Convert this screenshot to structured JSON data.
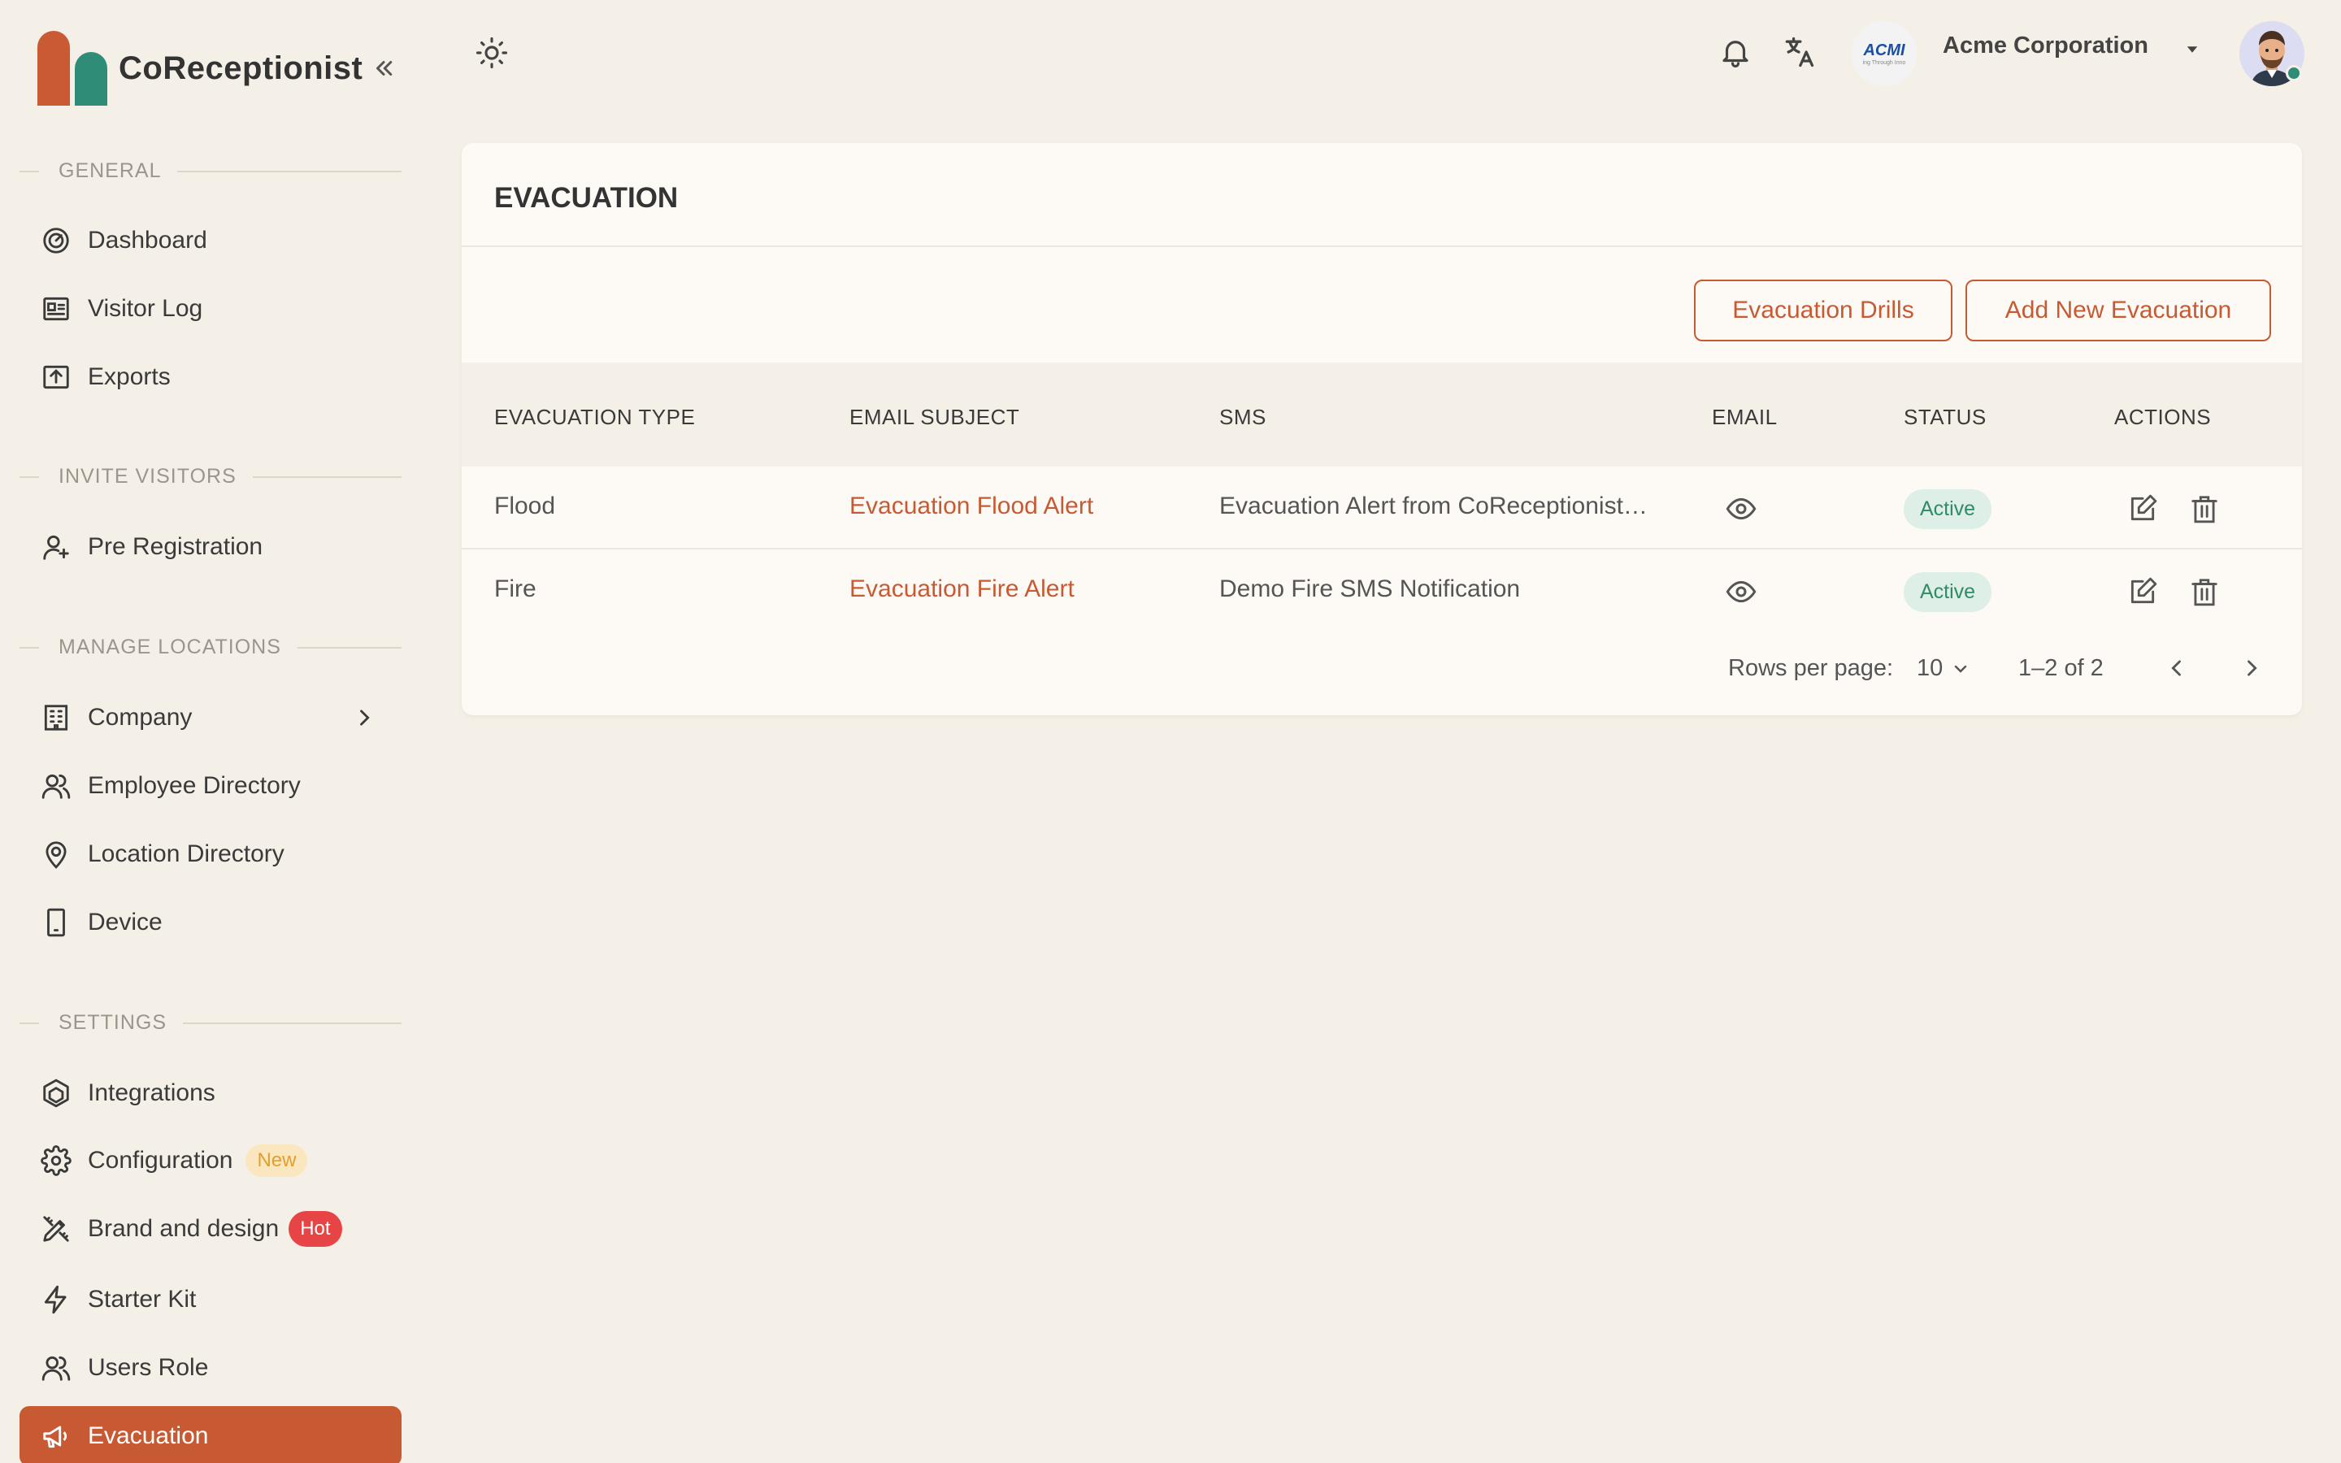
{
  "app": {
    "name": "CoReceptionist"
  },
  "sidebar": {
    "sections": {
      "general": "GENERAL",
      "invite": "INVITE VISITORS",
      "locations": "MANAGE LOCATIONS",
      "settings": "SETTINGS"
    },
    "items": {
      "dashboard": "Dashboard",
      "visitor_log": "Visitor Log",
      "exports": "Exports",
      "pre_registration": "Pre Registration",
      "company": "Company",
      "employee_directory": "Employee Directory",
      "location_directory": "Location Directory",
      "device": "Device",
      "integrations": "Integrations",
      "configuration": "Configuration",
      "configuration_badge": "New",
      "brand_design": "Brand and design",
      "brand_design_badge": "Hot",
      "starter_kit": "Starter Kit",
      "users_role": "Users Role",
      "evacuation": "Evacuation"
    }
  },
  "topbar": {
    "company_name": "Acme Corporation",
    "company_logo_text": "ACMI",
    "company_logo_tag": "ing Through Inno"
  },
  "page": {
    "title": "EVACUATION",
    "buttons": {
      "drills": "Evacuation Drills",
      "add_new": "Add New Evacuation"
    },
    "table": {
      "columns": {
        "type": "EVACUATION TYPE",
        "subject": "EMAIL SUBJECT",
        "sms": "SMS",
        "email": "EMAIL",
        "status": "STATUS",
        "actions": "ACTIONS"
      },
      "rows": [
        {
          "type": "Flood",
          "subject": "Evacuation Flood Alert",
          "sms": "Evacuation Alert from CoReceptionist…",
          "status": "Active"
        },
        {
          "type": "Fire",
          "subject": "Evacuation Fire Alert",
          "sms": "Demo Fire SMS Notification",
          "status": "Active"
        }
      ]
    },
    "pagination": {
      "rows_per_page_label": "Rows per page:",
      "rows_per_page": "10",
      "range": "1–2 of 2"
    }
  },
  "colors": {
    "accent": "#c75a33",
    "secondary": "#2e8c77",
    "background": "#f5f0e7",
    "status_active_bg": "#ddefe6",
    "status_active_text": "#2e8c66",
    "badge_hot": "#e74545",
    "badge_new_bg": "#fae6bf"
  }
}
